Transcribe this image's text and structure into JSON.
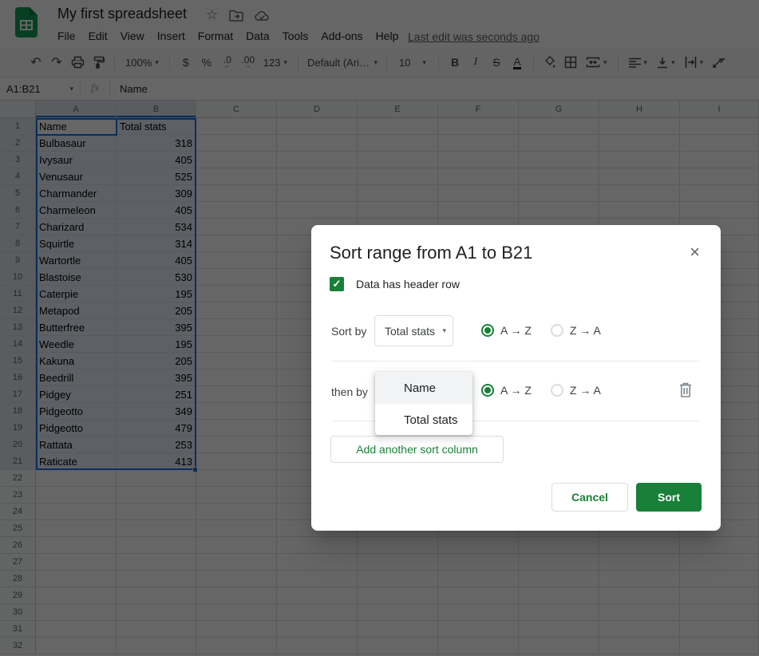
{
  "app": {
    "title": "My first spreadsheet",
    "menu": [
      "File",
      "Edit",
      "View",
      "Insert",
      "Format",
      "Data",
      "Tools",
      "Add-ons",
      "Help"
    ],
    "last_edit": "Last edit was seconds ago"
  },
  "icons": {
    "undo": "↶",
    "redo": "↷",
    "star": "☆",
    "caret": "▾",
    "close": "×",
    "check": "✓",
    "arrow_left": "←",
    "arrow_right": "→"
  },
  "toolbar": {
    "zoom": "100%",
    "currency": "$",
    "percent": "%",
    "decimal_decrease": ".0",
    "decimal_increase": ".00",
    "more_formats": "123",
    "font": "Default (Ari…",
    "font_size": "10",
    "bold": "B",
    "italic": "I",
    "strikethrough": "S",
    "text_color": "A"
  },
  "formula_bar": {
    "range": "A1:B21",
    "fx_label": "fx",
    "value": "Name"
  },
  "grid": {
    "columns": [
      "A",
      "B",
      "C",
      "D",
      "E",
      "F",
      "G",
      "H",
      "I"
    ],
    "row_count": 32,
    "selected_columns": [
      "A",
      "B"
    ],
    "selected_rows": 21,
    "cells": [
      [
        "Name",
        "Total stats"
      ],
      [
        "Bulbasaur",
        "318"
      ],
      [
        "Ivysaur",
        "405"
      ],
      [
        "Venusaur",
        "525"
      ],
      [
        "Charmander",
        "309"
      ],
      [
        "Charmeleon",
        "405"
      ],
      [
        "Charizard",
        "534"
      ],
      [
        "Squirtle",
        "314"
      ],
      [
        "Wartortle",
        "405"
      ],
      [
        "Blastoise",
        "530"
      ],
      [
        "Caterpie",
        "195"
      ],
      [
        "Metapod",
        "205"
      ],
      [
        "Butterfree",
        "395"
      ],
      [
        "Weedle",
        "195"
      ],
      [
        "Kakuna",
        "205"
      ],
      [
        "Beedrill",
        "395"
      ],
      [
        "Pidgey",
        "251"
      ],
      [
        "Pidgeotto",
        "349"
      ],
      [
        "Pidgeotto",
        "479"
      ],
      [
        "Rattata",
        "253"
      ],
      [
        "Raticate",
        "413"
      ]
    ]
  },
  "dialog": {
    "title": "Sort range from A1 to B21",
    "header_checkbox": {
      "checked": true,
      "label": "Data has header row"
    },
    "rules": [
      {
        "label": "Sort by",
        "selected_column": "Total stats",
        "order_asc": "A → Z",
        "order_desc": "Z → A",
        "selected_order": "asc"
      },
      {
        "label": "then by",
        "order_asc": "A → Z",
        "order_desc": "Z → A",
        "selected_order": "asc"
      }
    ],
    "open_dropdown": {
      "options": [
        "Name",
        "Total stats"
      ],
      "highlighted": "Name"
    },
    "add_column_label": "Add another sort column",
    "cancel_label": "Cancel",
    "sort_label": "Sort"
  },
  "colors": {
    "accent_green": "#188038",
    "selection_blue": "#1a73e8",
    "logo_green": "#0f9d58"
  }
}
